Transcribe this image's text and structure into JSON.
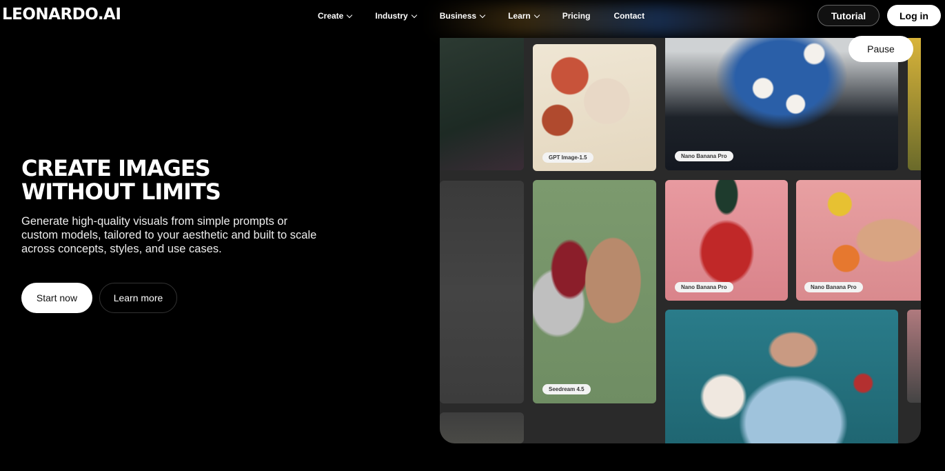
{
  "header": {
    "logo": "LEONARDO.AI",
    "nav": [
      {
        "label": "Create",
        "has_dropdown": true
      },
      {
        "label": "Industry",
        "has_dropdown": true
      },
      {
        "label": "Business",
        "has_dropdown": true
      },
      {
        "label": "Learn",
        "has_dropdown": true
      },
      {
        "label": "Pricing",
        "has_dropdown": false
      },
      {
        "label": "Contact",
        "has_dropdown": false
      }
    ],
    "tutorial_label": "Tutorial",
    "login_label": "Log in"
  },
  "hero": {
    "title_line1": "CREATE IMAGES",
    "title_line2": "WITHOUT LIMITS",
    "subtitle": "Generate high-quality visuals from simple prompts or custom models, tailored to your aesthetic and built to scale across concepts, styles, and use cases.",
    "start_label": "Start now",
    "learn_label": "Learn more"
  },
  "gallery": {
    "pause_label": "Pause",
    "tags": {
      "tile1": "GPT Image-1.5",
      "tile2": "Nano Banana Pro",
      "tile3": "Nano Banana Pro",
      "tile4": "Nano Banana Pro",
      "tile5": "Seedream 4.5"
    }
  },
  "colors": {
    "background": "#000000",
    "gallery_bg": "#2a2a2a",
    "button_light": "#ffffff"
  }
}
